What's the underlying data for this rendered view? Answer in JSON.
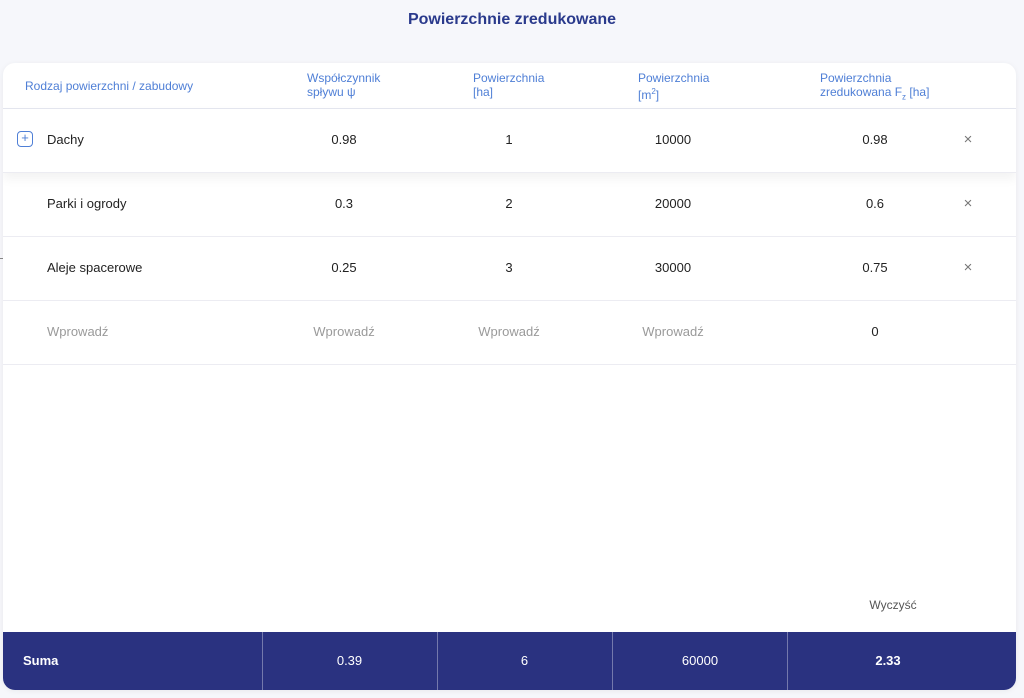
{
  "page": {
    "title": "Powierzchnie zredukowane"
  },
  "table": {
    "headers": {
      "type": "Rodzaj powierzchni / zabudowy",
      "coef_line1": "Współczynnik",
      "coef_line2": "spływu ψ",
      "area_ha_line1": "Powierzchnia",
      "area_ha_line2": "[ha]",
      "area_m2_line1": "Powierzchnia",
      "area_m2_unit_open": "[m",
      "area_m2_unit_sup": "2",
      "area_m2_unit_close": "]",
      "reduced_line1": "Powierzchnia",
      "reduced_line2_text": "zredukowana F",
      "reduced_line2_sub": "z",
      "reduced_line2_unit": " [ha]"
    },
    "rows": [
      {
        "name": "Dachy",
        "coef": "0.98",
        "area_ha": "1",
        "area_m2": "10000",
        "reduced": "0.98",
        "remove_icon": "close-icon"
      },
      {
        "name": "Parki i ogrody",
        "coef": "0.3",
        "area_ha": "2",
        "area_m2": "20000",
        "reduced": "0.6",
        "remove_icon": "close-icon"
      },
      {
        "name": "Aleje spacerowe",
        "coef": "0.25",
        "area_ha": "3",
        "area_m2": "30000",
        "reduced": "0.75",
        "remove_icon": "close-icon"
      }
    ],
    "new_row": {
      "name_placeholder": "Wprowadź",
      "coef_placeholder": "Wprowadź",
      "area_ha_placeholder": "Wprowadź",
      "area_m2_placeholder": "Wprowadź",
      "reduced": "0"
    },
    "expand_symbol": "+",
    "remove_symbol": "×"
  },
  "actions": {
    "clear_label": "Wyczyść"
  },
  "summary": {
    "label": "Suma",
    "coef": "0.39",
    "area_ha": "6",
    "area_m2": "60000",
    "reduced": "2.33"
  },
  "colors": {
    "accent": "#4f7fd6",
    "title": "#2a3a8c",
    "summary_bg": "#2a3280"
  }
}
